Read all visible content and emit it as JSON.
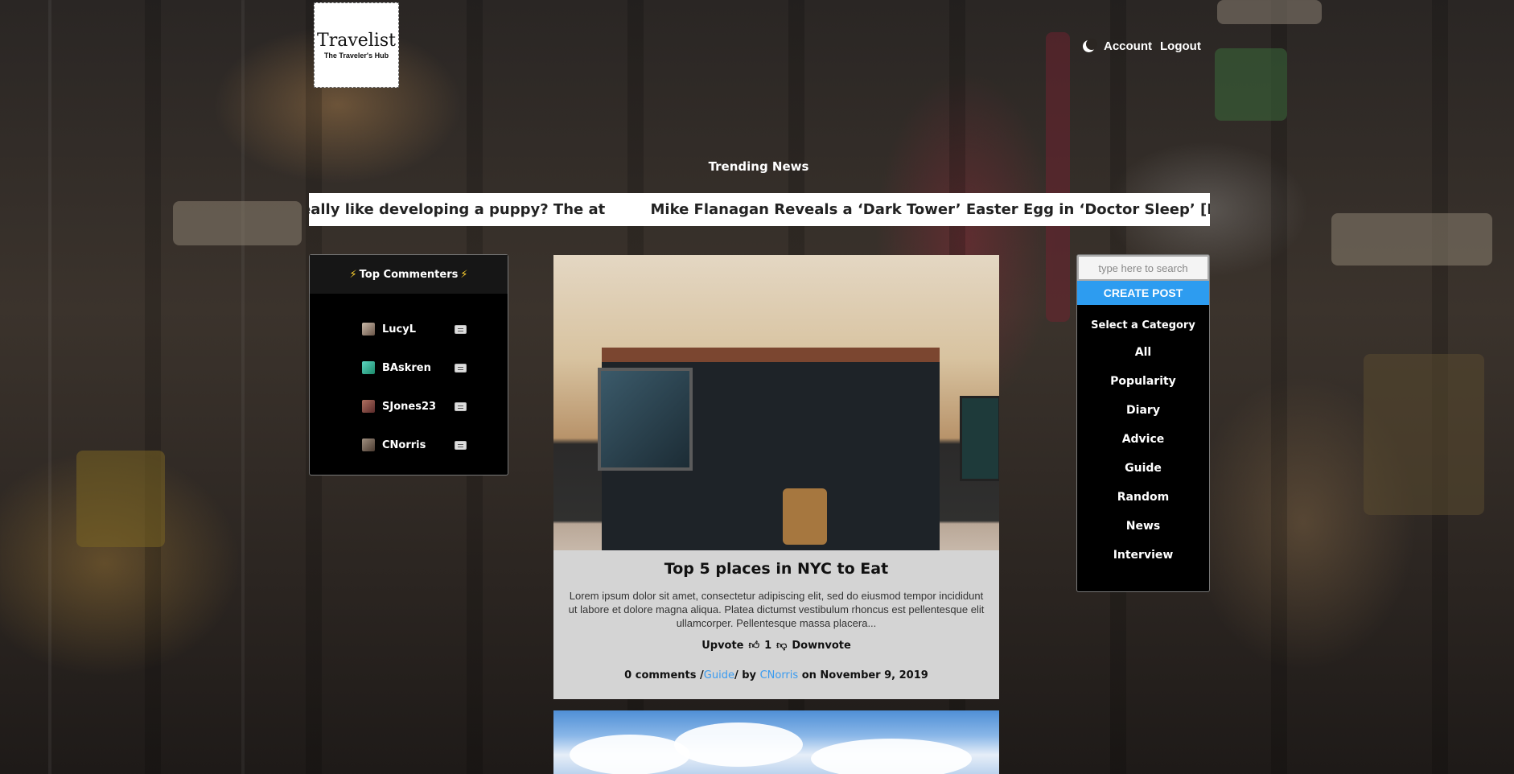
{
  "brand": {
    "title": "Travelist",
    "subtitle": "The Traveler's Hub"
  },
  "topnav": {
    "theme_icon": "moon-icon",
    "account": "Account",
    "logout": "Logout"
  },
  "trending": {
    "heading": "Trending News",
    "items": [
      "eally like developing a puppy? The at",
      "Mike Flanagan Reveals a ‘Dark Tower’ Easter Egg in ‘Doctor Sleep’ [Interview]"
    ]
  },
  "top_commenters": {
    "heading": "Top Commenters",
    "users": [
      {
        "name": "LucyL"
      },
      {
        "name": "BAskren"
      },
      {
        "name": "SJones23"
      },
      {
        "name": "CNorris"
      }
    ]
  },
  "post": {
    "title": "Top 5 places in NYC to Eat",
    "excerpt": "Lorem ipsum dolor sit amet, consectetur adipiscing elit, sed do eiusmod tempor incididunt ut labore et dolore magna aliqua. Platea dictumst vestibulum rhoncus est pellentesque elit ullamcorper. Pellentesque massa placera...",
    "upvote_label": "Upvote",
    "vote_count": "1",
    "downvote_label": "Downvote",
    "comments": "0 comments /",
    "category": "Guide",
    "by": "/ by",
    "author": "CNorris",
    "date": "on November 9, 2019"
  },
  "sidebar": {
    "search_placeholder": "type here to search",
    "create_post": "CREATE POST",
    "category_heading": "Select a Category",
    "categories": [
      "All",
      "Popularity",
      "Diary",
      "Advice",
      "Guide",
      "Random",
      "News",
      "Interview"
    ]
  },
  "colors": {
    "accent": "#2d9cf0",
    "link": "#3a9bf0",
    "bolt": "#ffd230"
  }
}
